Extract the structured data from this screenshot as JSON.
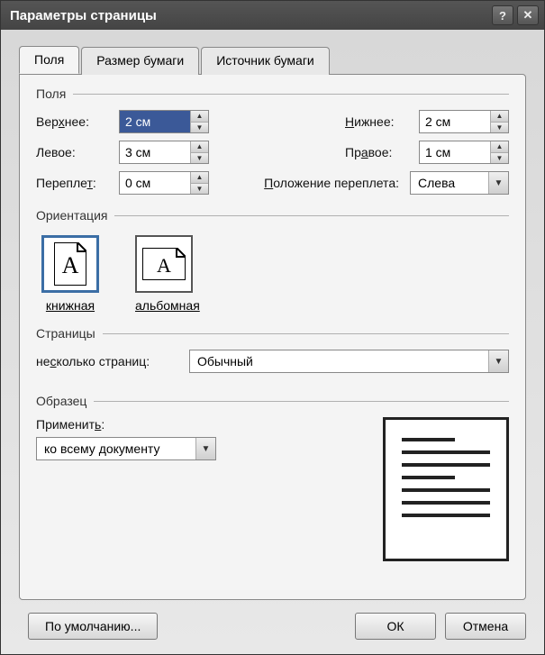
{
  "window": {
    "title": "Параметры страницы"
  },
  "tabs": {
    "fields": "Поля",
    "paper_size": "Размер бумаги",
    "paper_source": "Источник бумаги"
  },
  "groups": {
    "margins": "Поля",
    "orientation": "Ориентация",
    "pages": "Страницы",
    "sample": "Образец"
  },
  "margins": {
    "top_label": "Верхнее:",
    "top_value": "2 см",
    "bottom_label": "Нижнее:",
    "bottom_value": "2 см",
    "left_label": "Левое:",
    "left_value": "3 см",
    "right_label": "Правое:",
    "right_value": "1 см",
    "gutter_label": "Переплет:",
    "gutter_value": "0 см",
    "gutter_pos_label": "Положение переплета:",
    "gutter_pos_value": "Слева"
  },
  "orientation": {
    "portrait": "книжная",
    "landscape": "альбомная"
  },
  "pages": {
    "multi_label": "несколько страниц:",
    "multi_value": "Обычный"
  },
  "sample": {
    "apply_label": "Применить:",
    "apply_value": "ко всему документу"
  },
  "footer": {
    "default": "По умолчанию...",
    "ok": "ОК",
    "cancel": "Отмена"
  }
}
